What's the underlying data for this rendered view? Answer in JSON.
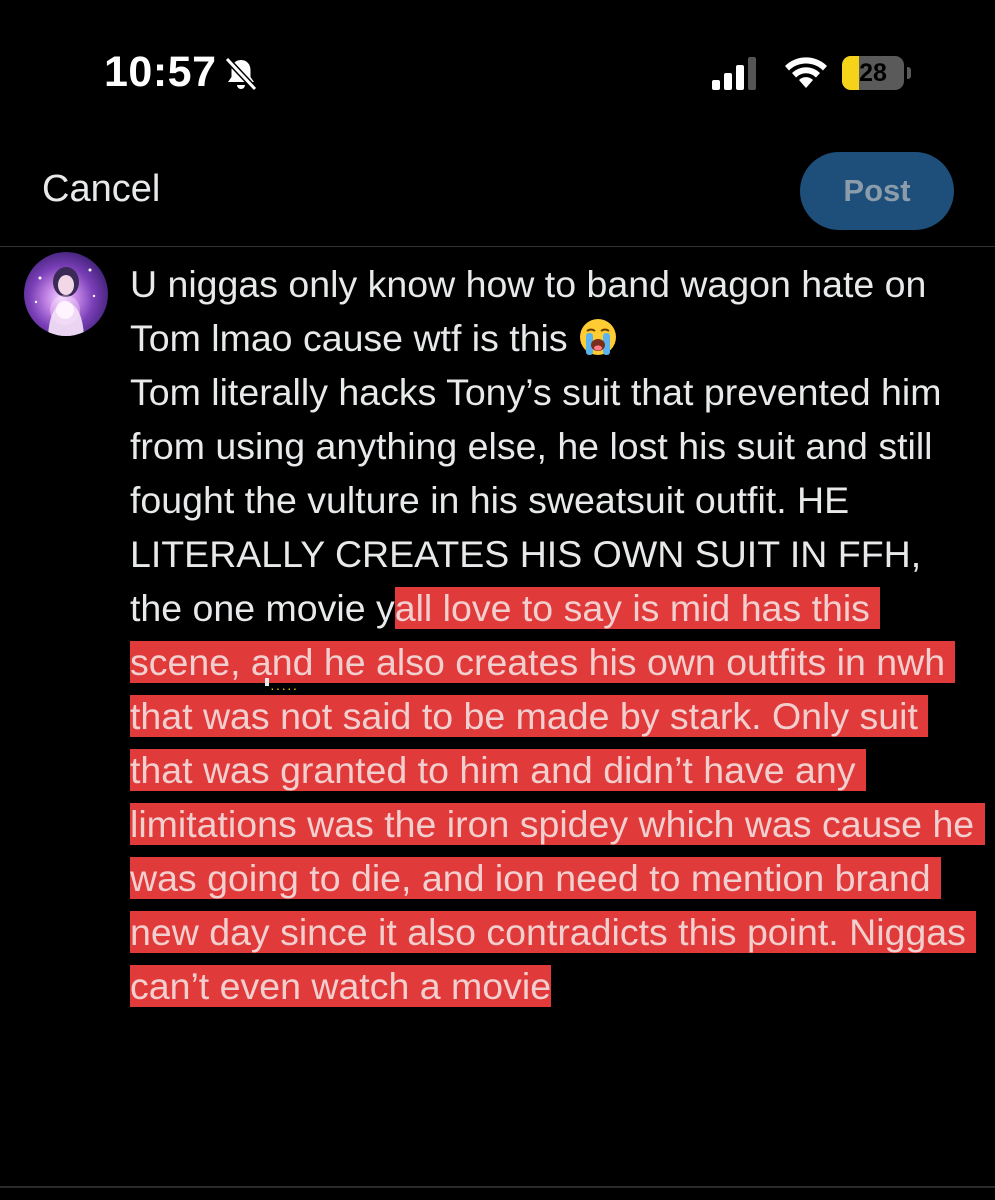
{
  "status_bar": {
    "time": "10:57",
    "battery_percent": "28",
    "battery_level": 0.28,
    "icons": [
      "bell-off-icon",
      "signal-icon",
      "wifi-icon",
      "battery-icon"
    ]
  },
  "header": {
    "cancel_label": "Cancel",
    "post_label": "Post"
  },
  "colors": {
    "background": "#000000",
    "text": "#e7e9ea",
    "post_button": "#1d4f7a",
    "highlight": "#e03a3a",
    "battery_fill": "#f5d31b"
  },
  "draft": {
    "segments": {
      "p1": "U niggas only know how to band wagon hate on Tom lmao cause wtf is this ",
      "p2": "\nTom literally hacks Tony’s suit that prevented him from using anything else, he lost his suit and still fought the vulture in his sweatsuit outfit. HE LITERALLY CREATES HIS OWN SUIT IN FFH, the one movie y",
      "p3": "all love to say is mid has this scene, and he also creates his own outfits in nwh that was not said to be made by stark. Only suit that was granted to him and didn’t have any limitations was the iron spidey which was cause he was going to die, and ion need to mention brand new day since it also contradicts this point. Niggas can’t even watch a movie"
    },
    "emoji": "loudly-crying-face-icon"
  }
}
